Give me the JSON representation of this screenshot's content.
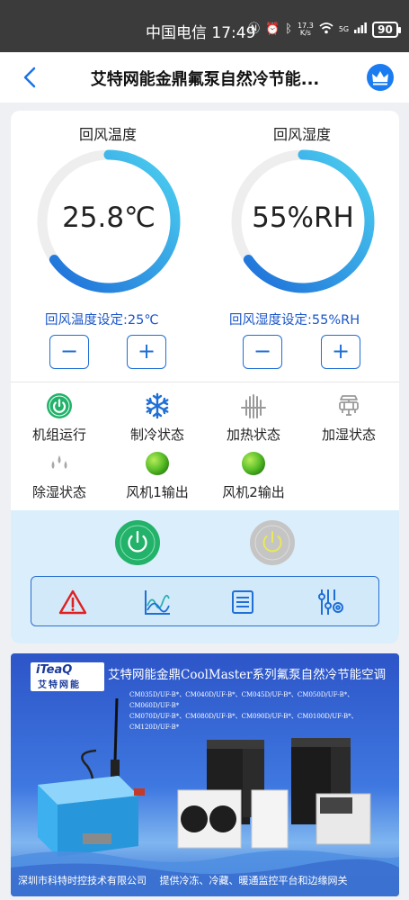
{
  "statusbar": {
    "carrier_time": "中国电信 17:49",
    "net_speed_value": "17.3",
    "net_speed_unit": "K/s",
    "signal_label": "5G",
    "battery": "90"
  },
  "header": {
    "title": "艾特网能金鼎氟泵自然冷节能..."
  },
  "gauges": {
    "temperature": {
      "title": "回风温度",
      "value": "25.8℃",
      "setpoint_label": "回风温度设定:25℃",
      "minus": "−",
      "plus": "+"
    },
    "humidity": {
      "title": "回风湿度",
      "value": "55%RH",
      "setpoint_label": "回风湿度设定:55%RH",
      "minus": "−",
      "plus": "+"
    }
  },
  "status_items": {
    "unit_running": "机组运行",
    "cooling": "制冷状态",
    "heating": "加热状态",
    "humidifying": "加湿状态",
    "dehumidifying": "除湿状态",
    "fan1": "风机1输出",
    "fan2": "风机2输出"
  },
  "colors": {
    "accent": "#1f6fd6",
    "gauge_start": "#1e6fd9",
    "gauge_end": "#4dd2f0",
    "running_green": "#22b26a",
    "indicator_green": "#5cc02a"
  },
  "banner": {
    "logo_brand": "iTeaQ",
    "logo_cn": "艾特网能",
    "title": "艾特网能金鼎CoolMaster系列氟泵自然冷节能空调",
    "models_line1": "CM035D/UF-B*、CM040D/UF-B*、CM045D/UF-B*、CM050D/UF-B*、CM060D/UF-B*",
    "models_line2": "CM070D/UF-B*、CM080D/UF-B*、CM090D/UF-B*、CM0100D/UF-B*、CM120D/UF-B*",
    "footer": "深圳市科特时控技术有限公司　 提供冷冻、冷藏、暖通监控平台和边缘网关"
  }
}
